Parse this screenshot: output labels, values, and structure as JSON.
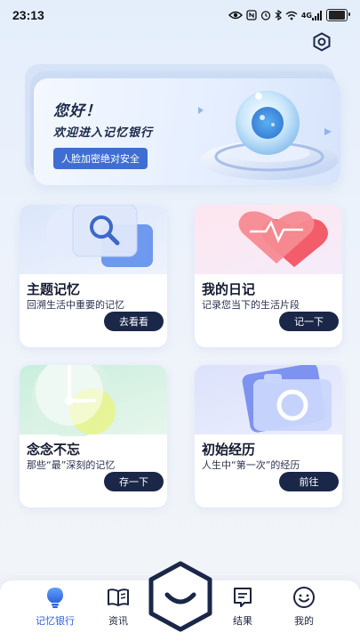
{
  "status_bar": {
    "time": "23:13",
    "icons": [
      "eye-icon",
      "nfc-icon",
      "alarm-icon",
      "bluetooth-icon",
      "wifi-icon",
      "signal-4g-icon",
      "battery-icon"
    ],
    "network": "4G",
    "battery_level": 0.9
  },
  "hero": {
    "title": "您好！",
    "subtitle": "欢迎进入记忆银行",
    "button_label": "人脸加密绝对安全"
  },
  "cards": [
    {
      "title": "主题记忆",
      "description": "回溯生活中重要的记忆",
      "button_label": "去看看",
      "icon": "magnifier-icon"
    },
    {
      "title": "我的日记",
      "description": "记录您当下的生活片段",
      "button_label": "记一下",
      "icon": "heart-pulse-icon"
    },
    {
      "title": "念念不忘",
      "description": "那些“最”深刻的记忆",
      "button_label": "存一下",
      "icon": "clock-icon"
    },
    {
      "title": "初始经历",
      "description": "人生中“第一次”的经历",
      "button_label": "前往",
      "icon": "camera-icon"
    }
  ],
  "bottom_nav": {
    "items": [
      {
        "label": "记忆银行",
        "icon": "lightbulb-icon",
        "active": true
      },
      {
        "label": "资讯",
        "icon": "book-icon",
        "active": false
      },
      {
        "label": "结果",
        "icon": "message-icon",
        "active": false
      },
      {
        "label": "我的",
        "icon": "smile-icon",
        "active": false
      }
    ],
    "center_icon": "hexagon-smile-icon"
  },
  "colors": {
    "primary": "#2f63d8",
    "dark_button": "#1a2748",
    "hero_button": "#3f6ed3"
  }
}
